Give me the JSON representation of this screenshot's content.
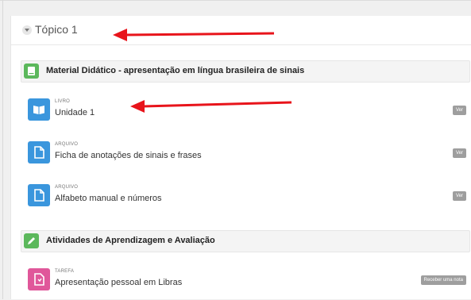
{
  "topic": {
    "title": "Tópico 1"
  },
  "sections": [
    {
      "title": "Material Didático - apresentação em língua brasileira de sinais",
      "icon": "book-icon",
      "color": "#5cb85c"
    },
    {
      "title": "Atividades de Aprendizagem e Avaliação",
      "icon": "pencil-icon",
      "color": "#5cb85c"
    }
  ],
  "activities": [
    {
      "type": "LIVRO",
      "name": "Unidade 1",
      "badge": "Ver",
      "icon": "book-open-icon",
      "color": "#3a96dd"
    },
    {
      "type": "ARQUIVO",
      "name": "Ficha de anotações de sinais e frases",
      "badge": "Ver",
      "icon": "file-icon",
      "color": "#3a96dd"
    },
    {
      "type": "ARQUIVO",
      "name": "Alfabeto manual e números",
      "badge": "Ver",
      "icon": "file-icon",
      "color": "#3a96dd"
    },
    {
      "type": "TAREFA",
      "name": "Apresentação pessoal em Libras",
      "badge": "Receber uma nota",
      "icon": "assignment-icon",
      "color": "#e0579a"
    }
  ],
  "annotations": {
    "arrow_color": "#e8141b"
  }
}
